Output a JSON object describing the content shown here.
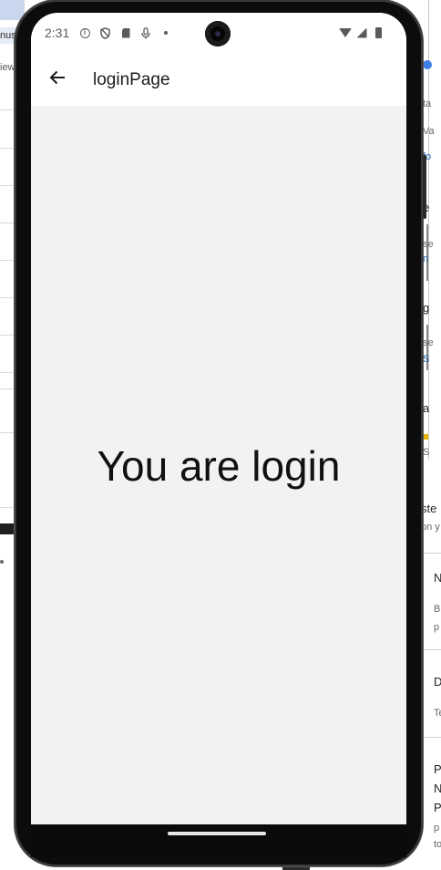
{
  "background": {
    "left_fragments": {
      "tab_text": "nus",
      "view_text": "iew"
    },
    "right_fragments": [
      {
        "text": "ta",
        "kind": "small"
      },
      {
        "text": "Va",
        "kind": "small"
      },
      {
        "text": "fo",
        "kind": "link"
      },
      {
        "text": "e",
        "kind": "normal"
      },
      {
        "text": "se",
        "kind": "small"
      },
      {
        "text": "n",
        "kind": "link"
      },
      {
        "text": "g",
        "kind": "normal"
      },
      {
        "text": "se",
        "kind": "small"
      },
      {
        "text": "S",
        "kind": "link"
      },
      {
        "text": "a",
        "kind": "normal"
      },
      {
        "text": "S",
        "kind": "small"
      },
      {
        "text": "ste",
        "kind": "normal"
      },
      {
        "text": "on y",
        "kind": "small"
      },
      {
        "text": "N",
        "kind": "normal"
      },
      {
        "text": "B",
        "kind": "small"
      },
      {
        "text": "p",
        "kind": "small"
      },
      {
        "text": "D",
        "kind": "normal"
      },
      {
        "text": "Te",
        "kind": "small"
      },
      {
        "text": "P",
        "kind": "normal"
      },
      {
        "text": "N",
        "kind": "normal"
      },
      {
        "text": "P",
        "kind": "normal"
      },
      {
        "text": "p",
        "kind": "small"
      },
      {
        "text": "to",
        "kind": "small"
      }
    ]
  },
  "status_bar": {
    "time": "2:31",
    "left_icons": [
      "info-icon",
      "shield-icon",
      "sd-card-icon",
      "microphone-icon",
      "dot-icon"
    ],
    "right_icons": [
      "wifi-icon",
      "signal-icon",
      "battery-icon"
    ]
  },
  "app_bar": {
    "back_icon": "arrow-left-icon",
    "title": "loginPage"
  },
  "content": {
    "message": "You are login"
  },
  "colors": {
    "app_bar_bg": "#ffffff",
    "content_bg": "#f2f2f2",
    "text_primary": "#111111",
    "status_icon": "#5a5a5a",
    "phone_frame": "#0c0c0c"
  }
}
